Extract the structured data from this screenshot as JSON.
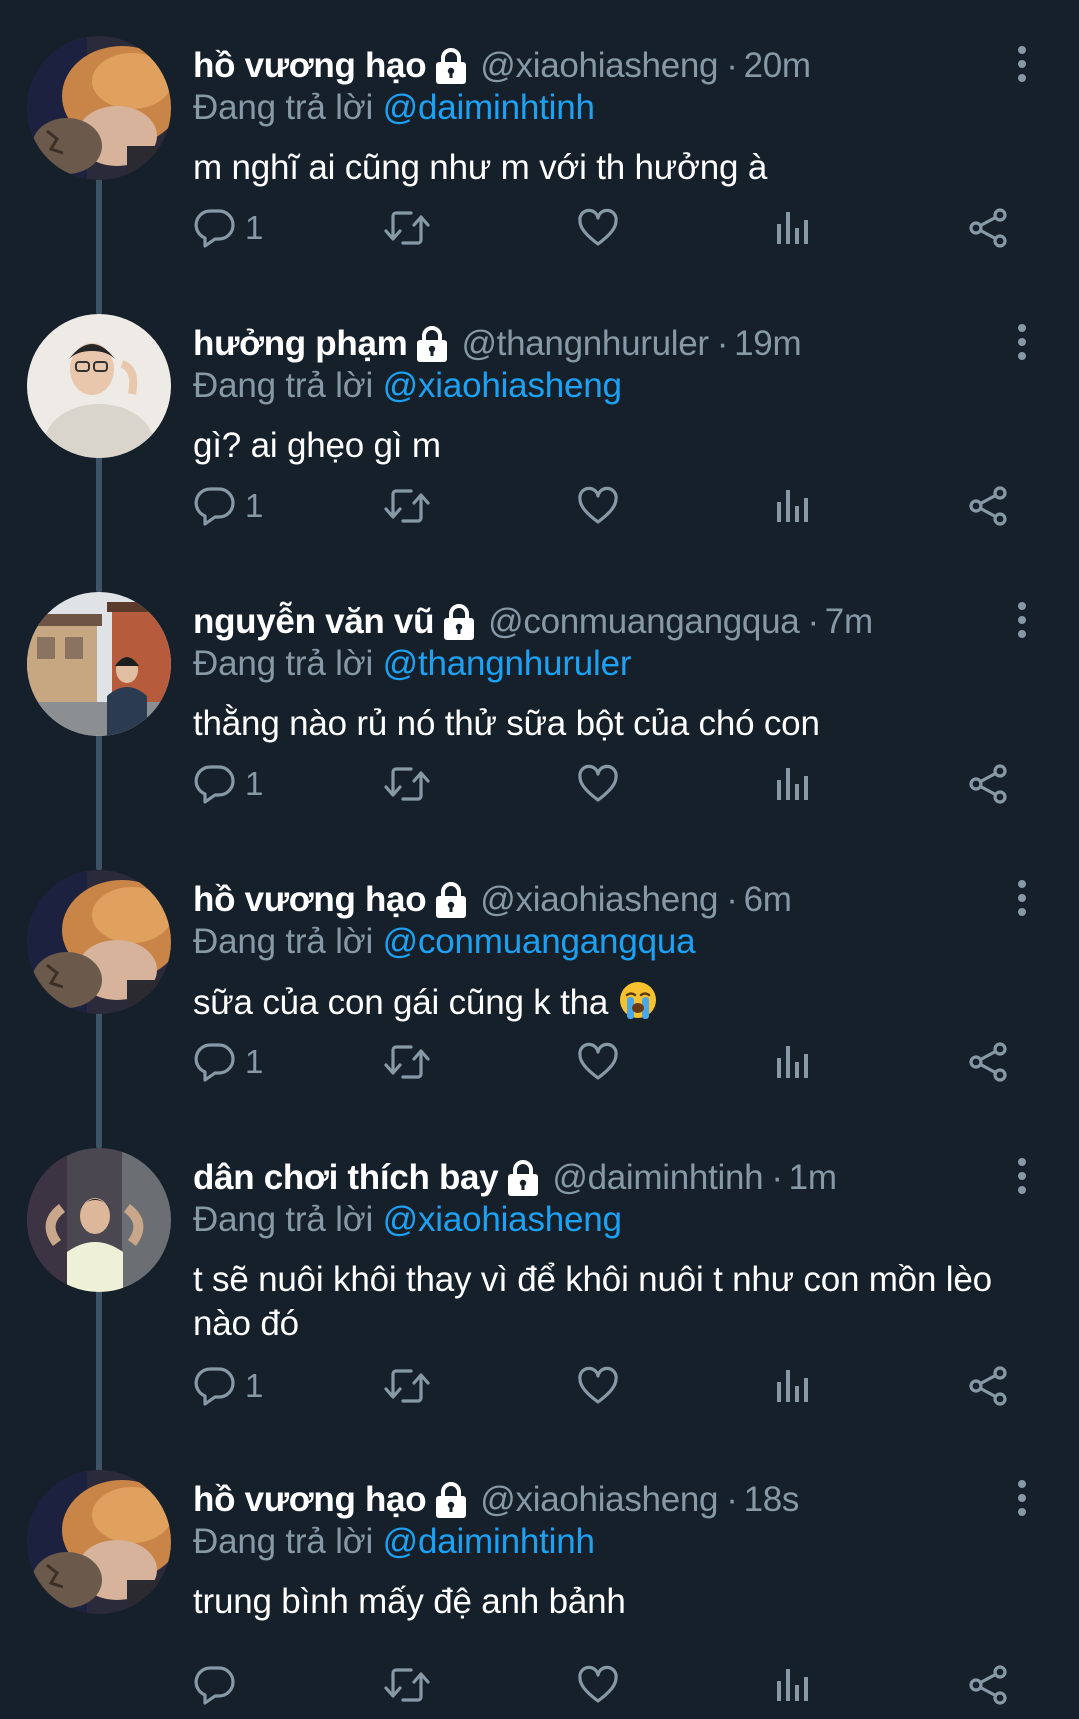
{
  "colors": {
    "background": "#15202b",
    "text_primary": "#ffffff",
    "text_secondary": "#8899a6",
    "mention": "#1da1f2",
    "thread_line": "#3d5466"
  },
  "icons": {
    "reply": "speech-bubble-icon",
    "retweet": "retweet-icon",
    "like": "heart-icon",
    "analytics": "bar-chart-icon",
    "share": "share-icon",
    "more": "vertical-dots-icon",
    "protected": "lock-icon"
  },
  "tweets": [
    {
      "name": "hồ vương hạo",
      "handle": "@xiaohiasheng",
      "separator": "·",
      "time": "20m",
      "reply_prefix": "Đang trả lời",
      "reply_to": "@daiminhtinh",
      "text": "m nghĩ ai cũng như m với th hưởng à",
      "reply_count": "1"
    },
    {
      "name": "hưởng phạm",
      "handle": "@thangnhuruler",
      "separator": "·",
      "time": "19m",
      "reply_prefix": "Đang trả lời",
      "reply_to": "@xiaohiasheng",
      "text": "gì? ai ghẹo gì m",
      "reply_count": "1"
    },
    {
      "name": "nguyễn văn vũ",
      "handle": "@conmuangangqua",
      "separator": "·",
      "time": "7m",
      "reply_prefix": "Đang trả lời",
      "reply_to": "@thangnhuruler",
      "text": "thằng nào rủ nó thử sữa bột của chó con",
      "reply_count": "1"
    },
    {
      "name": "hồ vương hạo",
      "handle": "@xiaohiasheng",
      "separator": "·",
      "time": "6m",
      "reply_prefix": "Đang trả lời",
      "reply_to": "@conmuangangqua",
      "text": "sữa của con gái cũng k tha",
      "emoji": "loudly-crying-face",
      "reply_count": "1"
    },
    {
      "name": "dân chơi thích bay",
      "handle": "@daiminhtinh",
      "separator": "·",
      "time": "1m",
      "reply_prefix": "Đang trả lời",
      "reply_to": "@xiaohiasheng",
      "text": "t sẽ nuôi khôi thay vì để khôi nuôi t như con mồn lèo nào đó",
      "reply_count": "1"
    },
    {
      "name": "hồ vương hạo",
      "handle": "@xiaohiasheng",
      "separator": "·",
      "time": "18s",
      "reply_prefix": "Đang trả lời",
      "reply_to": "@daiminhtinh",
      "text": "trung bình mấy đệ anh bảnh",
      "reply_count": ""
    }
  ]
}
